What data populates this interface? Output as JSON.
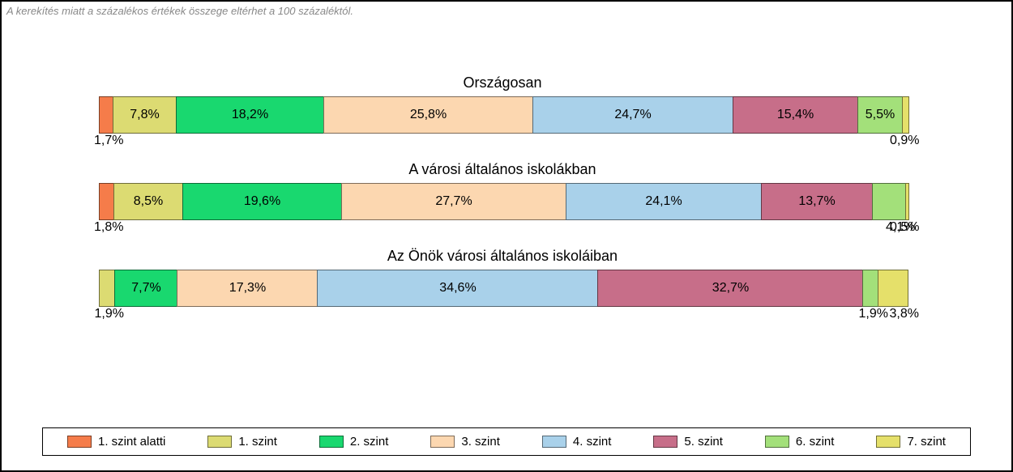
{
  "note": "A kerekítés miatt a százalékos értékek összege eltérhet a 100 százaléktól.",
  "legend": [
    {
      "label": "1. szint alatti",
      "color": "#f57c4a"
    },
    {
      "label": "1. szint",
      "color": "#dcdb72"
    },
    {
      "label": "2. szint",
      "color": "#19d86f"
    },
    {
      "label": "3. szint",
      "color": "#fcd7b0"
    },
    {
      "label": "4. szint",
      "color": "#a9d1ea"
    },
    {
      "label": "5. szint",
      "color": "#c76e89"
    },
    {
      "label": "6. szint",
      "color": "#a3e07a"
    },
    {
      "label": "7. szint",
      "color": "#e5e06a"
    }
  ],
  "chart_data": {
    "type": "bar",
    "stacked": true,
    "orientation": "horizontal",
    "unit": "%",
    "categories": [
      "1. szint alatti",
      "1. szint",
      "2. szint",
      "3. szint",
      "4. szint",
      "5. szint",
      "6. szint",
      "7. szint"
    ],
    "series": [
      {
        "name": "Országosan",
        "values": [
          1.7,
          7.8,
          18.2,
          25.8,
          24.7,
          15.4,
          5.5,
          0.9
        ],
        "labels": [
          "1,7%",
          "7,8%",
          "18,2%",
          "25,8%",
          "24,7%",
          "15,4%",
          "5,5%",
          "0,9%"
        ]
      },
      {
        "name": "A városi általános iskolákban",
        "values": [
          1.8,
          8.5,
          19.6,
          27.7,
          24.1,
          13.7,
          4.1,
          0.5
        ],
        "labels": [
          "1,8%",
          "8,5%",
          "19,6%",
          "27,7%",
          "24,1%",
          "13,7%",
          "4,1%",
          "0,5%"
        ]
      },
      {
        "name": "Az Önök városi általános iskoláiban",
        "values": [
          0.0,
          1.9,
          7.7,
          17.3,
          34.6,
          32.7,
          1.9,
          3.8
        ],
        "labels": [
          "",
          "1,9%",
          "7,7%",
          "17,3%",
          "34,6%",
          "32,7%",
          "1,9%",
          "3,8%"
        ]
      }
    ]
  }
}
